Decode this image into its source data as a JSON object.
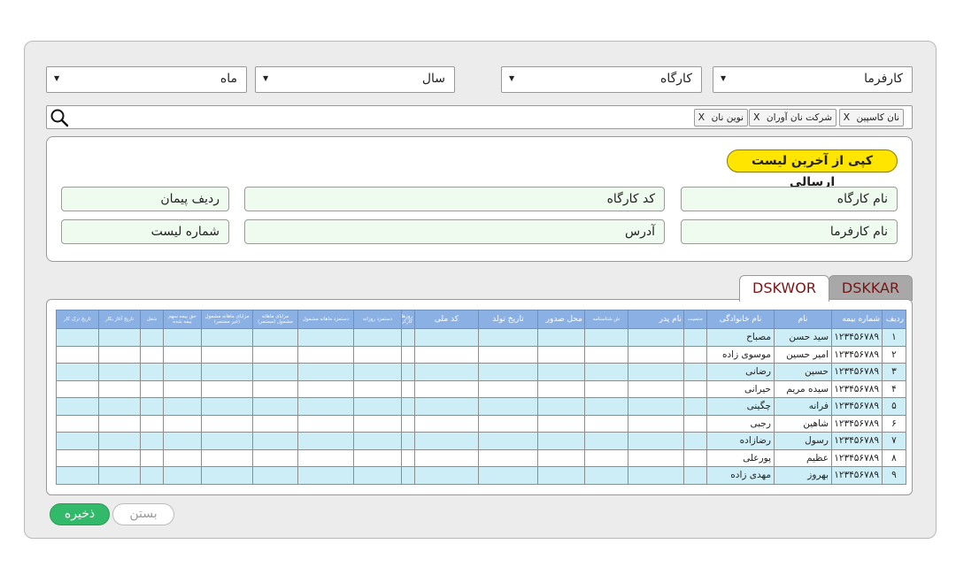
{
  "filters": {
    "employer": "کارفرما",
    "workshop": "کارگاه",
    "year": "سال",
    "month": "ماه"
  },
  "search": {
    "chips": [
      "نان کاسپین",
      "شرکت نان آوران",
      "نوین نان"
    ],
    "chip_close": "X"
  },
  "info": {
    "copy_button": "کپی از آخرین لیست ارسالی",
    "workshop_name": "نام کارگاه",
    "workshop_code": "کد کارگاه",
    "contract_row": "ردیف پیمان",
    "employer_name": "نام کارفرما",
    "address": "آدرس",
    "list_number": "شماره لیست"
  },
  "tabs": {
    "dskkar": "DSKKAR",
    "dskwor": "DSKWOR"
  },
  "table": {
    "headers": [
      "ردیف",
      "شماره بیمه",
      "نام",
      "نام خانوادگی",
      "جنسیت",
      "نام پدر",
      "ش شناسنامه",
      "محل صدور",
      "تاریخ تولد",
      "کد ملی",
      "روزهای کارکرد",
      "دستمزد روزانه",
      "دستمزد ماهانه مشمول",
      "مزایای ماهانه مشمول (مستمر)",
      "مزایای ماهانه مشمول (غیر مستمر)",
      "حق بیمه سهم بیمه شده",
      "شغل",
      "تاریخ آغاز بکار",
      "تاریخ ترک کار"
    ],
    "rows": [
      {
        "row": "۱",
        "ins": "۱۲۳۴۵۶۷۸۹",
        "first": "سید حسن",
        "last": "مصباح"
      },
      {
        "row": "۲",
        "ins": "۱۲۳۴۵۶۷۸۹",
        "first": "امیر حسین",
        "last": "موسوی زاده"
      },
      {
        "row": "۳",
        "ins": "۱۲۳۴۵۶۷۸۹",
        "first": "حسین",
        "last": "رضانی"
      },
      {
        "row": "۴",
        "ins": "۱۲۳۴۵۶۷۸۹",
        "first": "سیده مریم",
        "last": "حیرانی"
      },
      {
        "row": "۵",
        "ins": "۱۲۳۴۵۶۷۸۹",
        "first": "فرانه",
        "last": "چگینی"
      },
      {
        "row": "۶",
        "ins": "۱۲۳۴۵۶۷۸۹",
        "first": "شاهین",
        "last": "رجبی"
      },
      {
        "row": "۷",
        "ins": "۱۲۳۴۵۶۷۸۹",
        "first": "رسول",
        "last": "رضازاده"
      },
      {
        "row": "۸",
        "ins": "۱۲۳۴۵۶۷۸۹",
        "first": "عظیم",
        "last": "پورعلی"
      },
      {
        "row": "۹",
        "ins": "۱۲۳۴۵۶۷۸۹",
        "first": "بهروز",
        "last": "مهدی زاده"
      }
    ]
  },
  "actions": {
    "save": "ذخیره",
    "close": "بستن"
  },
  "colors": {
    "header_blue": "#8ab0e4",
    "row_cyan": "#cdeef7",
    "field_green": "#effbef",
    "copy_yellow": "#ffe500",
    "save_green": "#33b96a",
    "tab_text": "#7a1515"
  }
}
